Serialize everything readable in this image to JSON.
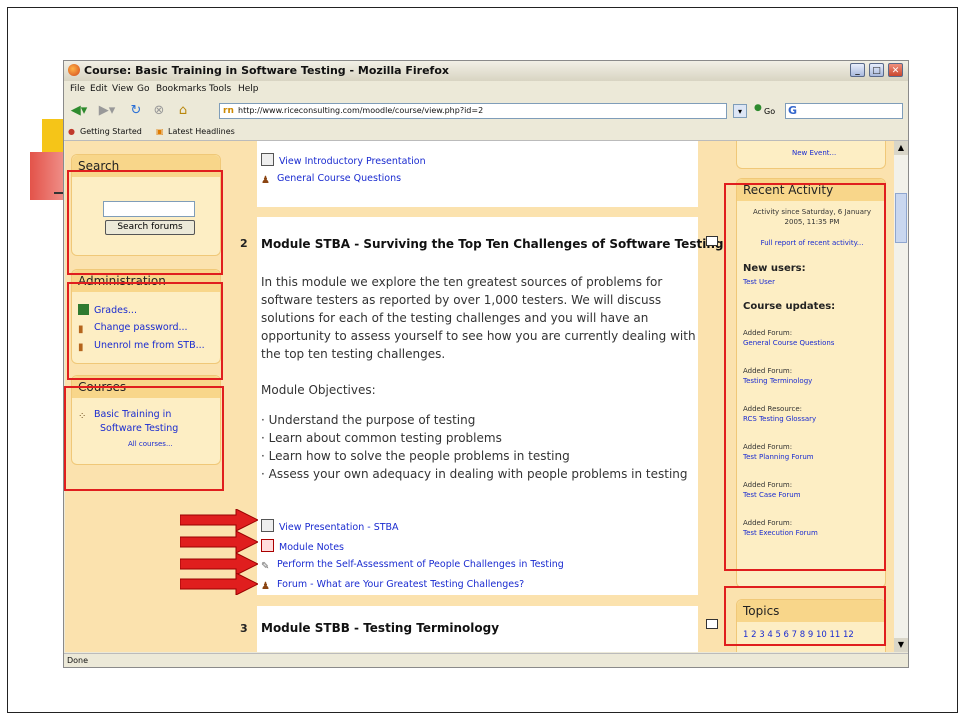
{
  "window": {
    "title": "Course: Basic Training in Software Testing - Mozilla Firefox",
    "menu": [
      "File",
      "Edit",
      "View",
      "Go",
      "Bookmarks",
      "Tools",
      "Help"
    ],
    "url": "http://www.riceconsulting.com/moodle/course/view.php?id=2",
    "go_label": "Go",
    "search_logo": "G",
    "bookmarks": [
      "Getting Started",
      "Latest Headlines"
    ],
    "status": "Done"
  },
  "left": {
    "search": {
      "title": "Search",
      "input_value": "",
      "button": "Search forums"
    },
    "admin": {
      "title": "Administration",
      "items": [
        "Grades...",
        "Change password...",
        "Unenrol me from STB..."
      ]
    },
    "courses": {
      "title": "Courses",
      "course_line1": "Basic Training in",
      "course_line2": "Software Testing",
      "all_courses": "All courses..."
    }
  },
  "main": {
    "top_links": [
      "View Introductory Presentation",
      "General Course Questions"
    ],
    "section2": {
      "number": "2",
      "heading": "Module STBA - Surviving the Top Ten Challenges of Software Testing",
      "para": [
        "In this module we explore the ten greatest sources of problems for",
        "software testers as reported by over 1,000 testers. We will discuss",
        "solutions for each of the testing challenges and you will have an",
        "opportunity to assess yourself to see how you are currently dealing with",
        "the top ten testing challenges."
      ],
      "objectives_label": "Module Objectives:",
      "objectives": [
        "· Understand the purpose of testing",
        "· Learn about common testing problems",
        "· Learn how to solve the people problems in testing",
        "· Assess your own adequacy in dealing with people problems in testing"
      ],
      "resources": [
        "View Presentation - STBA",
        "Module Notes",
        "Perform the Self-Assessment of People Challenges in Testing",
        "Forum - What are Your Greatest Testing Challenges?"
      ]
    },
    "section3": {
      "number": "3",
      "heading": "Module STBB - Testing Terminology"
    }
  },
  "right": {
    "new_event": "New Event...",
    "recent": {
      "title": "Recent Activity",
      "since_line1": "Activity since Saturday, 6 January",
      "since_line2": "2005, 11:35 PM",
      "full_report": "Full report of recent activity...",
      "new_users_label": "New users:",
      "new_user": "Test User",
      "updates_label": "Course updates:",
      "updates": [
        {
          "type": "Added Forum:",
          "name": "General Course Questions"
        },
        {
          "type": "Added Forum:",
          "name": "Testing Terminology"
        },
        {
          "type": "Added Resource:",
          "name": "RCS Testing Glossary"
        },
        {
          "type": "Added Forum:",
          "name": "Test Planning Forum"
        },
        {
          "type": "Added Forum:",
          "name": "Test Case Forum"
        },
        {
          "type": "Added Forum:",
          "name": "Test Execution Forum"
        }
      ]
    },
    "topics": {
      "title": "Topics",
      "numbers": "1 2 3 4 5 6 7 8 9 10 11 12"
    }
  },
  "colors": {
    "annotation_red": "#e01e1e",
    "moodle_bg": "#fbe2ae",
    "link": "#1a2bd0"
  }
}
